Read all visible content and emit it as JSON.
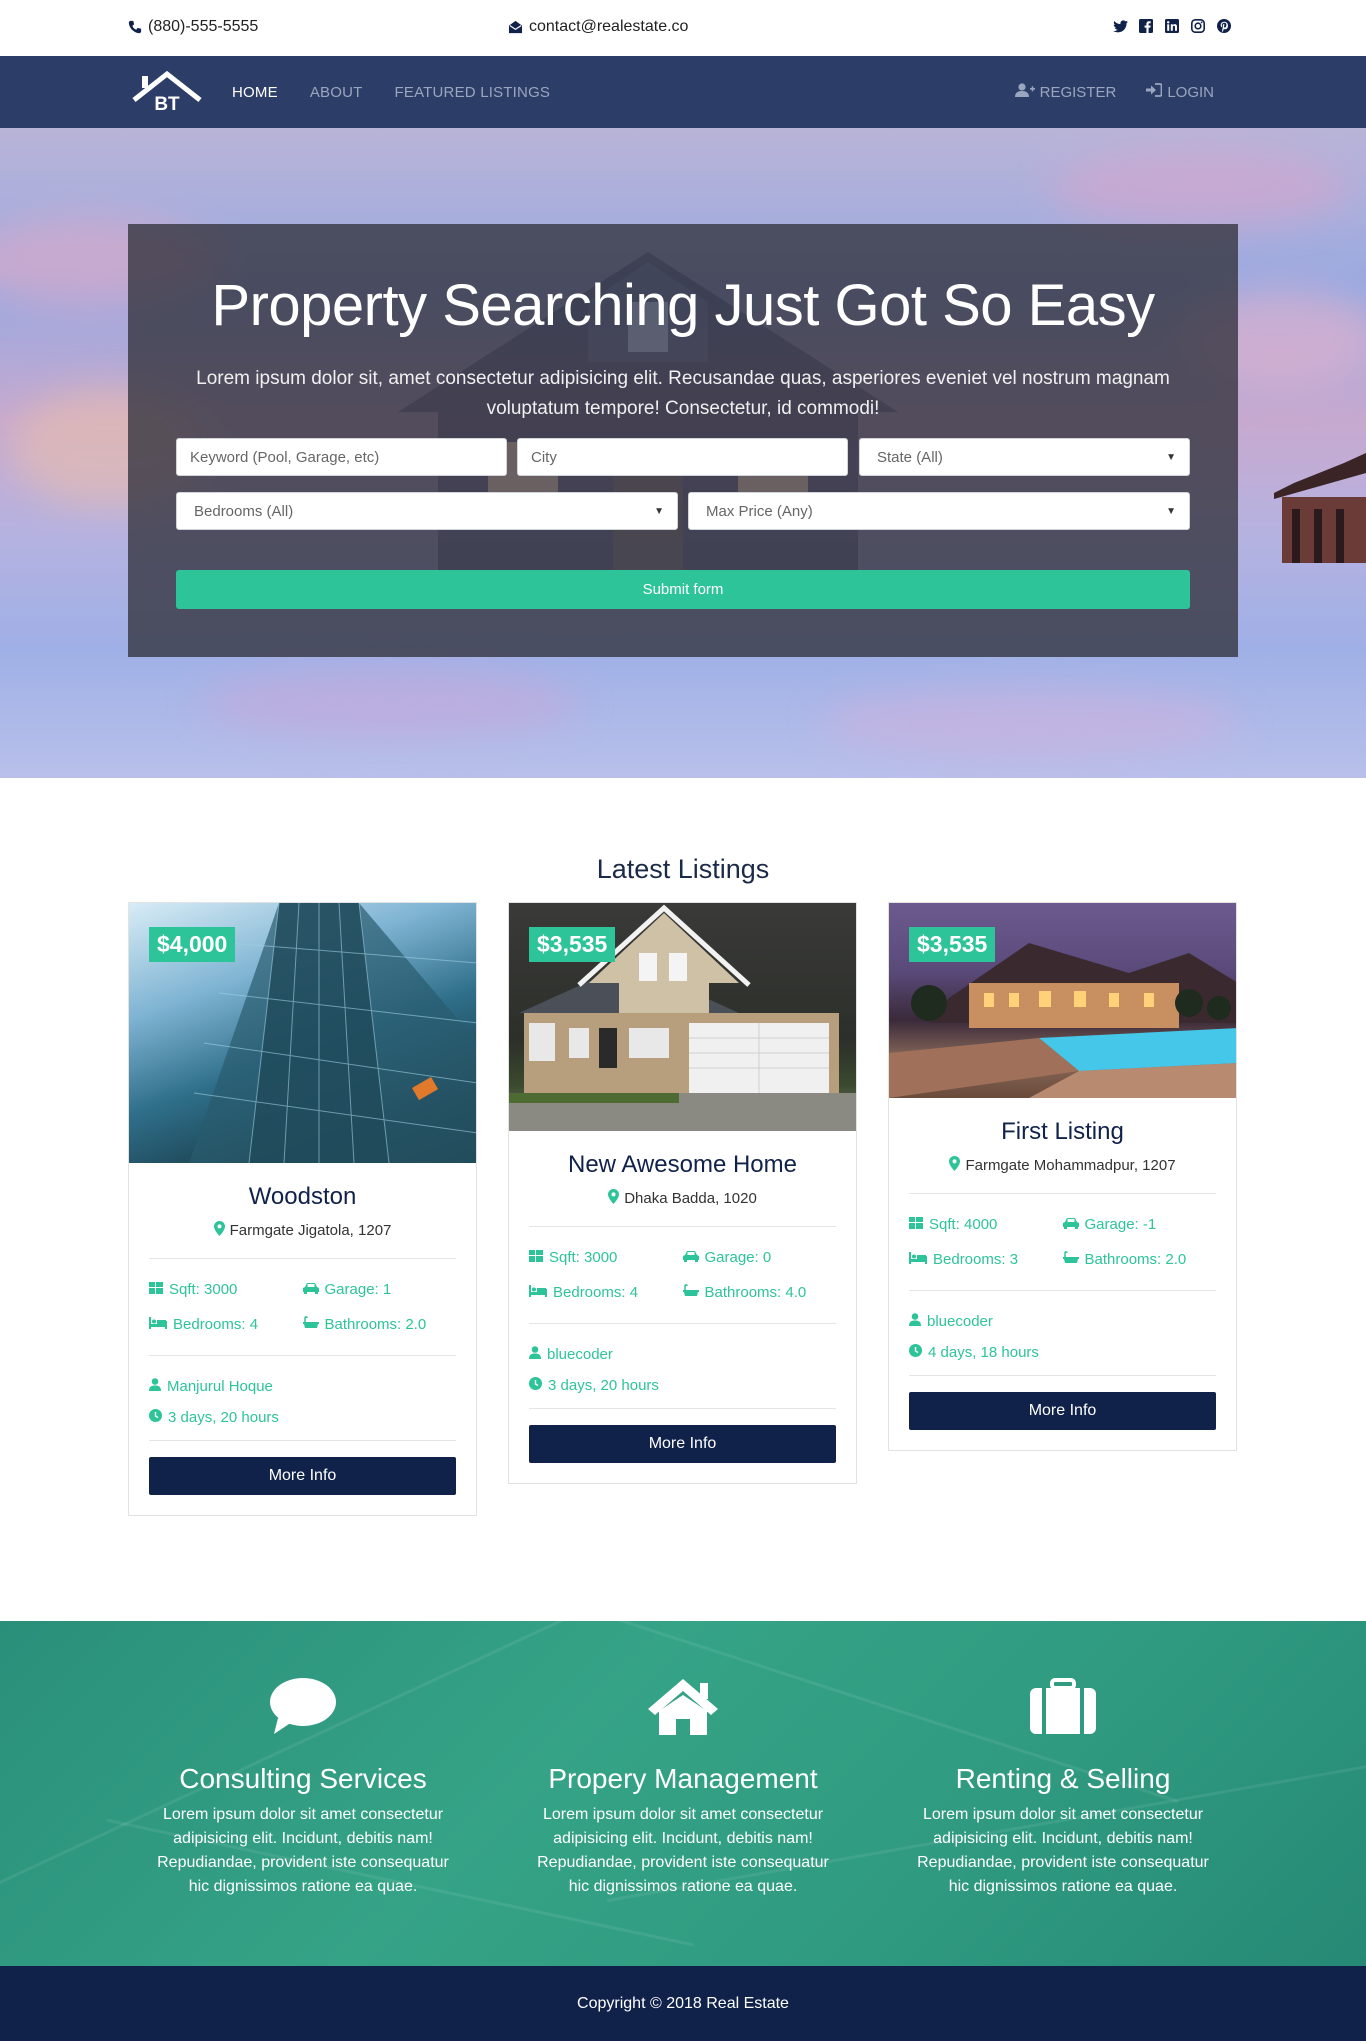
{
  "topbar": {
    "phone": "(880)-555-5555",
    "email": "contact@realestate.co",
    "socials": [
      "twitter-icon",
      "facebook-icon",
      "linkedin-icon",
      "instagram-icon",
      "pinterest-icon"
    ]
  },
  "nav": {
    "logo_text": "BT",
    "links": [
      {
        "label": "HOME",
        "active": true
      },
      {
        "label": "ABOUT",
        "active": false
      },
      {
        "label": "FEATURED LISTINGS",
        "active": false
      }
    ],
    "register": "REGISTER",
    "login": "LOGIN"
  },
  "hero": {
    "title": "Property Searching Just Got So Easy",
    "lead": "Lorem ipsum dolor sit, amet consectetur adipisicing elit. Recusandae quas, asperiores eveniet vel nostrum magnam voluptatum tempore! Consectetur, id commodi!",
    "keyword_placeholder": "Keyword (Pool, Garage, etc)",
    "city_placeholder": "City",
    "state_value": "State (All)",
    "bedrooms_value": "Bedrooms (All)",
    "maxprice_value": "Max Price (Any)",
    "submit_label": "Submit form"
  },
  "listings": {
    "heading": "Latest Listings",
    "more_label": "More Info",
    "items": [
      {
        "price": "$4,000",
        "name": "Woodston",
        "location": "Farmgate Jigatola, 1207",
        "sqft": "Sqft: 3000",
        "garage": "Garage: 1",
        "bedrooms": "Bedrooms: 4",
        "bathrooms": "Bathrooms: 2.0",
        "agent": "Manjurul Hoque",
        "age": "3 days, 20 hours"
      },
      {
        "price": "$3,535",
        "name": "New Awesome Home",
        "location": "Dhaka Badda, 1020",
        "sqft": "Sqft: 3000",
        "garage": "Garage: 0",
        "bedrooms": "Bedrooms: 4",
        "bathrooms": "Bathrooms: 4.0",
        "agent": "bluecoder",
        "age": "3 days, 20 hours"
      },
      {
        "price": "$3,535",
        "name": "First Listing",
        "location": "Farmgate Mohammadpur, 1207",
        "sqft": "Sqft: 4000",
        "garage": "Garage: -1",
        "bedrooms": "Bedrooms: 3",
        "bathrooms": "Bathrooms: 2.0",
        "agent": "bluecoder",
        "age": "4 days, 18 hours"
      }
    ]
  },
  "services": [
    {
      "icon": "comment-icon",
      "title": "Consulting Services",
      "text": "Lorem ipsum dolor sit amet consectetur adipisicing elit. Incidunt, debitis nam! Repudiandae, provident iste consequatur hic dignissimos ratione ea quae."
    },
    {
      "icon": "home-icon",
      "title": "Propery Management",
      "text": "Lorem ipsum dolor sit amet consectetur adipisicing elit. Incidunt, debitis nam! Repudiandae, provident iste consequatur hic dignissimos ratione ea quae."
    },
    {
      "icon": "suitcase-icon",
      "title": "Renting & Selling",
      "text": "Lorem ipsum dolor sit amet consectetur adipisicing elit. Incidunt, debitis nam! Repudiandae, provident iste consequatur hic dignissimos ratione ea quae."
    }
  ],
  "footer": {
    "copyright": "Copyright © 2018 Real Estate"
  },
  "colors": {
    "navy": "#10214a",
    "navbar": "#2c3e67",
    "accent": "#2ec49a"
  }
}
